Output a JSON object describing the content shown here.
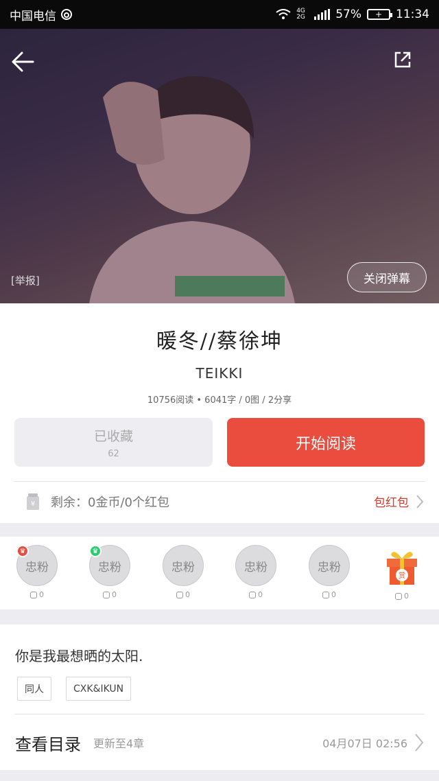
{
  "status_bar": {
    "carrier": "中国电信",
    "network": "4G 2G",
    "battery": "57%",
    "time": "11:34"
  },
  "hero": {
    "report_label": "[举报]",
    "danmaku_label": "关闭弹幕"
  },
  "book": {
    "title": "暖冬//蔡徐坤",
    "author": "TEIKKI",
    "stats": "10756阅读 • 6041字 / 0图 / 2分享"
  },
  "actions": {
    "favorite_label": "已收藏",
    "favorite_count": "62",
    "read_label": "开始阅读"
  },
  "balance": {
    "text": "剩余：0金币/0个红包",
    "link_label": "包红包"
  },
  "fans": [
    {
      "label": "忠粉",
      "count": "0",
      "badge_color": "#e74c3c"
    },
    {
      "label": "忠粉",
      "count": "0",
      "badge_color": "#2ecc71"
    },
    {
      "label": "忠粉",
      "count": "0"
    },
    {
      "label": "忠粉",
      "count": "0"
    },
    {
      "label": "忠粉",
      "count": "0"
    }
  ],
  "reward": {
    "label": "赏",
    "count": "0"
  },
  "description": {
    "summary": "你是我最想晒的太阳.",
    "tags": [
      "同人",
      "CXK&IKUN"
    ]
  },
  "toc": {
    "title": "查看目录",
    "update": "更新至4章",
    "date": "04月07日 02:56"
  },
  "colors": {
    "accent": "#ea4c3e",
    "link": "#d23b2e"
  }
}
